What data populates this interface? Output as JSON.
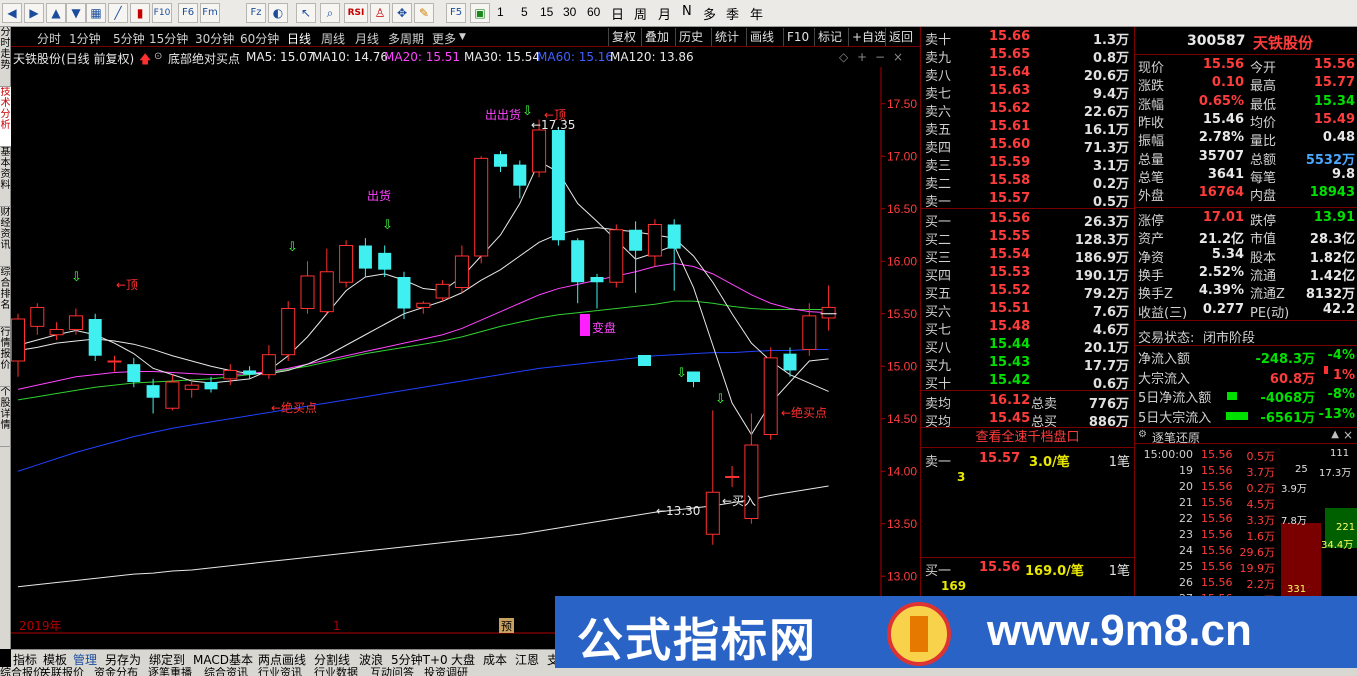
{
  "toolbar": {
    "icons": [
      "back-icon",
      "forward-icon",
      "up-icon",
      "down-icon",
      "refresh-icon",
      "table-icon",
      "line-chart-icon",
      "candle-icon",
      "f10-icon",
      "f6-icon",
      "fm-icon",
      "fz-icon",
      "calc-icon",
      "arrow-icon",
      "zoom-icon",
      "rsi-icon",
      "person-icon",
      "move-icon",
      "pencil-icon",
      "f5-icon",
      "screenshot-icon"
    ],
    "rsi_label": "RSI",
    "f10": "F10",
    "f6": "F6",
    "fm": "Fm",
    "fz": "Fz",
    "f5": "F5",
    "periods": [
      "1",
      "5",
      "15",
      "30",
      "60"
    ],
    "cn_periods": [
      "日",
      "周",
      "月",
      "N",
      "多",
      "季",
      "年"
    ]
  },
  "left_tabs": [
    "分时走势",
    "技术分析",
    "基本资料",
    "财经资讯",
    "综合排名",
    "行情报价",
    "个股详情"
  ],
  "period_bar": {
    "items": [
      "分时",
      "1分钟",
      "5分钟",
      "15分钟",
      "30分钟",
      "60分钟",
      "日线",
      "周线",
      "月线",
      "多周期",
      "更多"
    ],
    "active": "日线",
    "right_buttons": [
      "复权",
      "叠加",
      "历史",
      "统计",
      "画线",
      "F10",
      "标记",
      "+自选",
      "返回"
    ]
  },
  "info_bar": {
    "stock": "天铁股份(日线 前复权)",
    "indicator": "底部绝对买点",
    "ma5": "MA5: 15.07",
    "ma10": "MA10: 14.76",
    "ma20": "MA20: 15.51",
    "ma30": "MA30: 15.54",
    "ma60": "MA60: 15.16",
    "ma120": "MA120: 13.86",
    "colors": {
      "ma5": "#e8e8e8",
      "ma10": "#e8e8e8",
      "ma20": "#ff44ff",
      "ma30": "#44ff44",
      "ma60": "#4060ff",
      "ma120": "#e8e8e8"
    }
  },
  "chart_data": {
    "type": "candlestick",
    "ylim": [
      12.45,
      17.85
    ],
    "yticks": [
      "17.50",
      "17.00",
      "16.50",
      "16.00",
      "15.50",
      "15.00",
      "14.50",
      "14.00",
      "13.50",
      "13.00",
      "12.50"
    ],
    "year_label": "2019年",
    "month_marker": "1",
    "predict_badge": "预",
    "candles": [
      {
        "o": 15.05,
        "c": 15.45,
        "h": 15.5,
        "l": 14.9
      },
      {
        "o": 15.38,
        "c": 15.56,
        "h": 15.6,
        "l": 15.3
      },
      {
        "o": 15.3,
        "c": 15.35,
        "h": 15.42,
        "l": 15.25
      },
      {
        "o": 15.35,
        "c": 15.48,
        "h": 15.55,
        "l": 15.3
      },
      {
        "o": 15.45,
        "c": 15.1,
        "h": 15.5,
        "l": 15.05
      },
      {
        "o": 15.05,
        "c": 15.05,
        "h": 15.1,
        "l": 14.95
      },
      {
        "o": 15.02,
        "c": 14.85,
        "h": 15.08,
        "l": 14.8
      },
      {
        "o": 14.82,
        "c": 14.7,
        "h": 14.88,
        "l": 14.55
      },
      {
        "o": 14.6,
        "c": 14.85,
        "h": 14.92,
        "l": 14.58
      },
      {
        "o": 14.78,
        "c": 14.82,
        "h": 14.88,
        "l": 14.7
      },
      {
        "o": 14.85,
        "c": 14.78,
        "h": 14.9,
        "l": 14.75
      },
      {
        "o": 14.88,
        "c": 14.96,
        "h": 15.02,
        "l": 14.82
      },
      {
        "o": 14.96,
        "c": 14.92,
        "h": 15.0,
        "l": 14.88
      },
      {
        "o": 14.92,
        "c": 15.11,
        "h": 15.2,
        "l": 14.88
      },
      {
        "o": 15.11,
        "c": 15.55,
        "h": 15.62,
        "l": 15.05
      },
      {
        "o": 15.55,
        "c": 15.86,
        "h": 16.0,
        "l": 15.5
      },
      {
        "o": 15.52,
        "c": 15.9,
        "h": 16.12,
        "l": 15.5
      },
      {
        "o": 15.8,
        "c": 16.15,
        "h": 16.2,
        "l": 15.75
      },
      {
        "o": 16.15,
        "c": 15.93,
        "h": 16.22,
        "l": 15.85
      },
      {
        "o": 16.08,
        "c": 15.92,
        "h": 16.15,
        "l": 15.85
      },
      {
        "o": 15.85,
        "c": 15.55,
        "h": 15.9,
        "l": 15.45
      },
      {
        "o": 15.56,
        "c": 15.6,
        "h": 15.62,
        "l": 15.5
      },
      {
        "o": 15.65,
        "c": 15.78,
        "h": 15.82,
        "l": 15.62
      },
      {
        "o": 15.75,
        "c": 16.05,
        "h": 16.15,
        "l": 15.7
      },
      {
        "o": 16.05,
        "c": 16.98,
        "h": 17.0,
        "l": 15.98
      },
      {
        "o": 17.02,
        "c": 16.9,
        "h": 17.05,
        "l": 16.85
      },
      {
        "o": 16.92,
        "c": 16.72,
        "h": 16.96,
        "l": 16.6
      },
      {
        "o": 16.85,
        "c": 17.25,
        "h": 17.35,
        "l": 16.8
      },
      {
        "o": 17.25,
        "c": 16.2,
        "h": 17.28,
        "l": 16.15
      },
      {
        "o": 16.2,
        "c": 15.8,
        "h": 16.22,
        "l": 15.6
      },
      {
        "o": 15.85,
        "c": 15.8,
        "h": 15.88,
        "l": 15.55
      },
      {
        "o": 15.8,
        "c": 16.3,
        "h": 16.35,
        "l": 15.75
      },
      {
        "o": 16.3,
        "c": 16.1,
        "h": 16.38,
        "l": 15.7
      },
      {
        "o": 16.05,
        "c": 16.35,
        "h": 16.4,
        "l": 15.95
      },
      {
        "o": 16.35,
        "c": 16.12,
        "h": 16.4,
        "l": 15.72
      },
      {
        "o": 14.95,
        "c": 14.85,
        "h": 14.95,
        "l": 14.8
      },
      {
        "o": 13.4,
        "c": 13.8,
        "h": 14.58,
        "l": 13.3
      },
      {
        "o": 13.95,
        "c": 13.95,
        "h": 14.05,
        "l": 13.85
      },
      {
        "o": 13.55,
        "c": 14.25,
        "h": 14.55,
        "l": 13.5
      },
      {
        "o": 14.35,
        "c": 15.08,
        "h": 15.18,
        "l": 14.3
      },
      {
        "o": 15.12,
        "c": 14.96,
        "h": 15.18,
        "l": 14.9
      },
      {
        "o": 15.16,
        "c": 15.48,
        "h": 15.6,
        "l": 15.1
      },
      {
        "o": 15.46,
        "c": 15.56,
        "h": 15.77,
        "l": 15.34
      }
    ],
    "ma5": [
      15.2,
      15.25,
      15.3,
      15.34,
      15.3,
      15.22,
      15.12,
      14.98,
      14.92,
      14.86,
      14.84,
      14.86,
      14.88,
      14.96,
      15.1,
      15.28,
      15.5,
      15.72,
      15.85,
      15.88,
      15.82,
      15.74,
      15.72,
      15.85,
      16.05,
      16.25,
      16.55,
      16.95,
      16.85,
      16.55,
      16.38,
      16.2,
      16.02,
      16.08,
      16.15,
      15.75,
      15.2,
      14.65,
      14.35,
      14.65,
      14.85,
      15.05,
      15.07
    ],
    "ma10": [
      15.15,
      15.18,
      15.22,
      15.24,
      15.26,
      15.24,
      15.21,
      15.16,
      15.1,
      15.05,
      15.0,
      14.96,
      14.93,
      14.93,
      14.96,
      15.02,
      15.1,
      15.2,
      15.3,
      15.4,
      15.5,
      15.56,
      15.62,
      15.7,
      15.82,
      15.92,
      16.05,
      16.18,
      16.26,
      16.3,
      16.32,
      16.3,
      16.28,
      16.25,
      16.22,
      16.05,
      15.8,
      15.5,
      15.22,
      15.05,
      14.92,
      14.84,
      14.76
    ],
    "ma20": [
      14.78,
      14.82,
      14.86,
      14.9,
      14.92,
      14.94,
      14.95,
      14.95,
      14.94,
      14.93,
      14.92,
      14.92,
      14.93,
      14.95,
      14.98,
      15.02,
      15.06,
      15.1,
      15.14,
      15.18,
      15.22,
      15.26,
      15.3,
      15.36,
      15.44,
      15.52,
      15.6,
      15.68,
      15.74,
      15.78,
      15.82,
      15.86,
      15.9,
      15.95,
      15.98,
      15.95,
      15.88,
      15.78,
      15.68,
      15.6,
      15.55,
      15.52,
      15.51
    ],
    "ma30": [
      14.68,
      14.71,
      14.74,
      14.77,
      14.8,
      14.82,
      14.84,
      14.85,
      14.86,
      14.87,
      14.88,
      14.9,
      14.92,
      14.94,
      14.97,
      15.0,
      15.04,
      15.08,
      15.12,
      15.15,
      15.18,
      15.21,
      15.24,
      15.28,
      15.33,
      15.38,
      15.42,
      15.46,
      15.49,
      15.51,
      15.53,
      15.55,
      15.57,
      15.59,
      15.62,
      15.62,
      15.6,
      15.57,
      15.55,
      15.54,
      15.54,
      15.54,
      15.54
    ],
    "ma60": [
      14.0,
      14.06,
      14.12,
      14.18,
      14.23,
      14.28,
      14.33,
      14.37,
      14.41,
      14.44,
      14.47,
      14.5,
      14.53,
      14.56,
      14.59,
      14.62,
      14.65,
      14.68,
      14.71,
      14.74,
      14.77,
      14.8,
      14.83,
      14.86,
      14.89,
      14.92,
      14.95,
      14.98,
      15.0,
      15.02,
      15.04,
      15.06,
      15.08,
      15.1,
      15.11,
      15.12,
      15.13,
      15.13,
      15.14,
      15.15,
      15.15,
      15.16,
      15.16
    ],
    "ma120": [
      12.9,
      12.92,
      12.94,
      12.96,
      12.98,
      13.0,
      13.02,
      13.03,
      13.05,
      13.06,
      13.08,
      13.1,
      13.12,
      13.14,
      13.16,
      13.18,
      13.2,
      13.22,
      13.24,
      13.26,
      13.28,
      13.3,
      13.32,
      13.34,
      13.36,
      13.38,
      13.4,
      13.43,
      13.46,
      13.49,
      13.52,
      13.55,
      13.58,
      13.61,
      13.63,
      13.65,
      13.67,
      13.7,
      13.73,
      13.77,
      13.8,
      13.83,
      13.86
    ],
    "annotations": {
      "top1": "←顶",
      "sell1": "出货",
      "sell2": "出出货",
      "top2": "←顶",
      "high_price": "←17.35",
      "buy_point1": "←绝买点",
      "bianpan": "变盘",
      "low_price": "←13.30",
      "buy": "←买入",
      "buy_point2": "←绝买点"
    }
  },
  "orderbook": {
    "sell": [
      {
        "label": "卖十",
        "price": "15.66",
        "vol": "1.3万"
      },
      {
        "label": "卖九",
        "price": "15.65",
        "vol": "0.8万"
      },
      {
        "label": "卖八",
        "price": "15.64",
        "vol": "20.6万"
      },
      {
        "label": "卖七",
        "price": "15.63",
        "vol": "9.4万"
      },
      {
        "label": "卖六",
        "price": "15.62",
        "vol": "22.6万"
      },
      {
        "label": "卖五",
        "price": "15.61",
        "vol": "16.1万"
      },
      {
        "label": "卖四",
        "price": "15.60",
        "vol": "71.3万"
      },
      {
        "label": "卖三",
        "price": "15.59",
        "vol": "3.1万"
      },
      {
        "label": "卖二",
        "price": "15.58",
        "vol": "0.2万"
      },
      {
        "label": "卖一",
        "price": "15.57",
        "vol": "0.5万"
      }
    ],
    "buy": [
      {
        "label": "买一",
        "price": "15.56",
        "vol": "26.3万"
      },
      {
        "label": "买二",
        "price": "15.55",
        "vol": "128.3万"
      },
      {
        "label": "买三",
        "price": "15.54",
        "vol": "186.9万"
      },
      {
        "label": "买四",
        "price": "15.53",
        "vol": "190.1万"
      },
      {
        "label": "买五",
        "price": "15.52",
        "vol": "79.2万"
      },
      {
        "label": "买六",
        "price": "15.51",
        "vol": "7.6万"
      },
      {
        "label": "买七",
        "price": "15.48",
        "vol": "4.6万"
      },
      {
        "label": "买八",
        "price": "15.44",
        "vol": "20.1万"
      },
      {
        "label": "买九",
        "price": "15.43",
        "vol": "17.7万"
      },
      {
        "label": "买十",
        "price": "15.42",
        "vol": "0.6万"
      }
    ],
    "avg_sell": {
      "label": "卖均",
      "price": "16.12",
      "tlabel": "总卖",
      "vol": "776万"
    },
    "avg_buy": {
      "label": "买均",
      "price": "15.45",
      "tlabel": "总买",
      "vol": "886万"
    }
  },
  "quote": {
    "code": "300587",
    "name": "天铁股份",
    "rows": [
      [
        "现价",
        "15.56",
        "今开",
        "15.56"
      ],
      [
        "涨跌",
        "0.10",
        "最高",
        "15.77"
      ],
      [
        "涨幅",
        "0.65%",
        "最低",
        "15.34"
      ],
      [
        "昨收",
        "15.46",
        "均价",
        "15.49"
      ],
      [
        "振幅",
        "2.78%",
        "量比",
        "0.48"
      ],
      [
        "总量",
        "35707",
        "总额",
        "5532万"
      ],
      [
        "总笔",
        "3641",
        "每笔",
        "9.8"
      ],
      [
        "外盘",
        "16764",
        "内盘",
        "18943"
      ]
    ],
    "rows2": [
      [
        "涨停",
        "17.01",
        "跌停",
        "13.91"
      ],
      [
        "资产",
        "21.2亿",
        "市值",
        "28.3亿"
      ],
      [
        "净资",
        "5.34",
        "股本",
        "1.82亿"
      ],
      [
        "换手",
        "2.52%",
        "流通",
        "1.42亿"
      ],
      [
        "换手Z",
        "4.39%",
        "流通Z",
        "8132万"
      ],
      [
        "收益(三)",
        "0.277",
        "PE(动)",
        "42.2"
      ]
    ],
    "trade_state_label": "交易状态:",
    "trade_state": "闭市阶段",
    "flows": [
      [
        "净流入额",
        "-248.3万",
        "-4%"
      ],
      [
        "大宗流入",
        "60.8万",
        "1%"
      ],
      [
        "5日净流入额",
        "-4068万",
        "-8%"
      ],
      [
        "5日大宗流入",
        "-6561万",
        "-13%"
      ]
    ]
  },
  "tick_panel": {
    "button": "查看全速千档盘口",
    "sell_label": "卖一",
    "sell_price": "15.57",
    "sell_qty": "3.0/笔",
    "sell_cnt": "1笔",
    "sell_detail": "3",
    "buy_label": "买一",
    "buy_price": "15.56",
    "buy_qty": "169.0/笔",
    "buy_cnt": "1笔",
    "buy_detail": "169"
  },
  "trades": {
    "title": "逐笔还原",
    "rows": [
      [
        "15:00:00",
        "15.56",
        "0.5万",
        "",
        ""
      ],
      [
        "19",
        "15.56",
        "3.7万",
        "",
        ""
      ],
      [
        "20",
        "15.56",
        "0.2万",
        "",
        ""
      ],
      [
        "21",
        "15.56",
        "4.5万",
        "",
        ""
      ],
      [
        "22",
        "15.56",
        "3.3万",
        "",
        ""
      ],
      [
        "23",
        "15.56",
        "1.6万",
        "",
        ""
      ],
      [
        "24",
        "15.56",
        "29.6万",
        "",
        ""
      ],
      [
        "25",
        "15.56",
        "19.9万",
        "",
        ""
      ],
      [
        "26",
        "15.56",
        "2.2万",
        "",
        ""
      ],
      [
        "27",
        "15.56",
        "0.9万",
        "",
        ""
      ]
    ],
    "side_cols": [
      [
        "111",
        "17.3万"
      ],
      [
        "25",
        "3.9万"
      ],
      [
        "",
        "7.8万"
      ],
      [
        "221",
        "34.4万"
      ],
      [
        "331",
        ""
      ]
    ]
  },
  "bottom_bar": [
    "指标",
    "模板",
    "管理",
    "另存为",
    "绑定到",
    "MACD基本",
    "两点画线",
    "分割线",
    "波浪",
    "5分钟T+0",
    "大盘",
    "成本",
    "江恩",
    "支"
  ],
  "status_bar": [
    "综合报价",
    "关联报价",
    "资金分布",
    "逐笔重播",
    "综合资讯",
    "行业资讯",
    "行业数据",
    "互动问答",
    "投资调研"
  ],
  "watermark": {
    "cn": "公式指标网",
    "url": "www.9m8.cn"
  }
}
